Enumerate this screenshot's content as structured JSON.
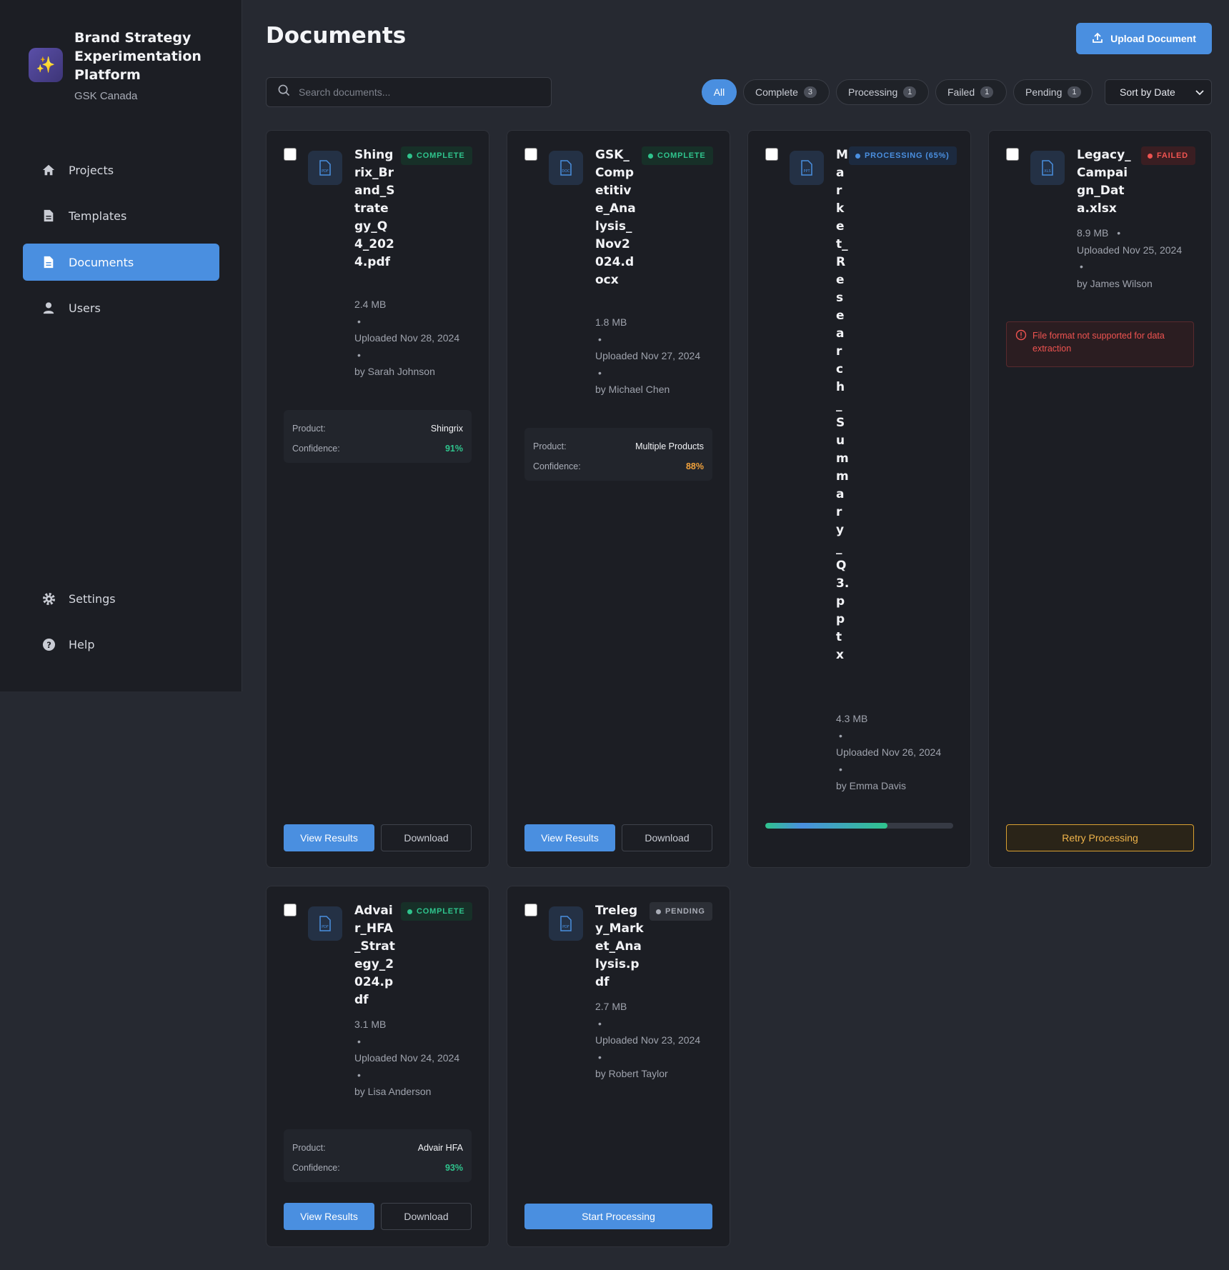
{
  "brand": {
    "title": "Brand Strategy Experimentation Platform",
    "subtitle": "GSK Canada",
    "logo_icon": "sparkle-icon"
  },
  "nav": {
    "items": [
      {
        "label": "Projects",
        "icon": "home-icon"
      },
      {
        "label": "Templates",
        "icon": "file-icon"
      },
      {
        "label": "Documents",
        "icon": "document-icon",
        "active": true
      },
      {
        "label": "Users",
        "icon": "user-icon"
      }
    ],
    "bottom": [
      {
        "label": "Settings",
        "icon": "gear-icon"
      },
      {
        "label": "Help",
        "icon": "help-icon"
      }
    ]
  },
  "header": {
    "title": "Documents",
    "upload_label": "Upload Document"
  },
  "search": {
    "placeholder": "Search documents..."
  },
  "filters": [
    {
      "label": "All",
      "count": "",
      "active": true
    },
    {
      "label": "Complete",
      "count": "3"
    },
    {
      "label": "Processing",
      "count": "1"
    },
    {
      "label": "Failed",
      "count": "1"
    },
    {
      "label": "Pending",
      "count": "1"
    }
  ],
  "sort": {
    "selected": "Sort by Date"
  },
  "labels": {
    "product": "Product:",
    "confidence": "Confidence:",
    "view_results": "View Results",
    "download": "Download",
    "retry": "Retry Processing",
    "start": "Start Processing",
    "bullet": "•"
  },
  "documents": [
    {
      "name": "Shingrix_Brand_Strategy_Q4_2024.pdf",
      "type": "PDF",
      "status": "COMPLETE",
      "size": "2.4 MB",
      "uploaded": "Uploaded Nov 28, 2024",
      "by": "by Sarah Johnson",
      "product": "Shingrix",
      "confidence": "91%"
    },
    {
      "name": "GSK_Competitive_Analysis_Nov2024.docx",
      "type": "DOC",
      "status": "COMPLETE",
      "size": "1.8 MB",
      "uploaded": "Uploaded Nov 27, 2024",
      "by": "by Michael Chen",
      "product": "Multiple Products",
      "confidence": "88%"
    },
    {
      "name": "Market_Research_Summary_Q3.pptx",
      "type": "PPT",
      "status": "PROCESSING (65%)",
      "progress": 0.65,
      "size": "4.3 MB",
      "uploaded": "Uploaded Nov 26, 2024",
      "by": "by Emma Davis"
    },
    {
      "name": "Legacy_Campaign_Data.xlsx",
      "type": "XLS",
      "status": "FAILED",
      "size": "8.9 MB",
      "uploaded": "Uploaded Nov 25, 2024",
      "by": "by James Wilson",
      "error": "File format not supported for data extraction"
    },
    {
      "name": "Advair_HFA_Strategy_2024.pdf",
      "type": "PDF",
      "status": "COMPLETE",
      "size": "3.1 MB",
      "uploaded": "Uploaded Nov 24, 2024",
      "by": "by Lisa Anderson",
      "product": "Advair HFA",
      "confidence": "93%"
    },
    {
      "name": "Trelegy_Market_Analysis.pdf",
      "type": "PDF",
      "status": "PENDING",
      "size": "2.7 MB",
      "uploaded": "Uploaded Nov 23, 2024",
      "by": "by Robert Taylor"
    }
  ],
  "colors": {
    "accent": "#4a8fe0",
    "complete": "#2fc48d",
    "failed": "#ef5350",
    "warning": "#f2a23c"
  }
}
